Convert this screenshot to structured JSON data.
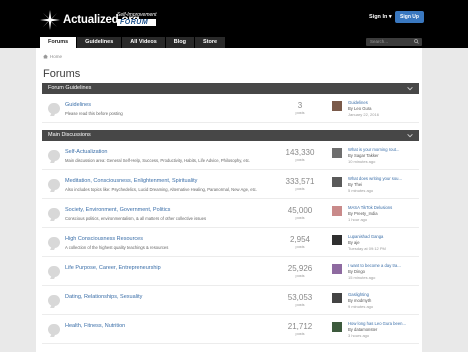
{
  "header": {
    "logo_text": "Actualized.org",
    "logo_tagline": "Self-Improvement",
    "logo_forum": "FORUM",
    "sign_in": "Sign In ▾",
    "sign_up": "Sign Up",
    "search_placeholder": "Search..."
  },
  "nav": {
    "tabs": [
      {
        "label": "Forums",
        "active": true
      },
      {
        "label": "Guidelines"
      },
      {
        "label": "All Videos"
      },
      {
        "label": "Blog"
      },
      {
        "label": "Store"
      }
    ]
  },
  "breadcrumb": {
    "home": "Home"
  },
  "page": {
    "title": "Forums"
  },
  "sections": [
    {
      "title": "Forum Guidelines",
      "forums": [
        {
          "title": "Guidelines",
          "desc": "Please read this before posting",
          "count": "3",
          "count_label": "posts",
          "last_title": "Guidelines",
          "last_by": "By Leo Gura",
          "last_time": "January 22, 2016",
          "avatar_color": "#7a5a4a"
        }
      ]
    },
    {
      "title": "Main Discussions",
      "forums": [
        {
          "title": "Self-Actualization",
          "desc": "Main discussion area: General Self-Help, Success, Productivity, Habits, Life Advice, Philosophy, etc.",
          "count": "143,330",
          "count_label": "posts",
          "last_title": "What is your morning rout...",
          "last_by": "By Sagar Takker",
          "last_time": "10 minutes ago",
          "avatar_color": "#6e6e6e"
        },
        {
          "title": "Meditation, Consciousness, Enlightenment, Spirituality",
          "desc": "Also includes topics like: Psychedelics, Lucid Dreaming, Alternative Healing, Paranormal, New Age, etc.",
          "count": "333,571",
          "count_label": "posts",
          "last_title": "What does writing your sou...",
          "last_by": "By Thei",
          "last_time": "5 minutes ago",
          "avatar_color": "#5a5a5a"
        },
        {
          "title": "Society, Environment, Government, Politics",
          "desc": "Conscious politics, environmentalism, & all matters of other collective issues",
          "count": "45,000",
          "count_label": "posts",
          "last_title": "MASA TikTok Delusions",
          "last_by": "By Preety_India",
          "last_time": "1 hour ago",
          "avatar_color": "#c98a8a"
        },
        {
          "title": "High Consciousness Resources",
          "desc": "A collection of the highest quality teachings & resources",
          "count": "2,954",
          "count_label": "posts",
          "last_title": "Lupanishad Ganga",
          "last_by": "By aje",
          "last_time": "Tuesday at 09:12 PM",
          "avatar_color": "#2f2f2f"
        },
        {
          "title": "Life Purpose, Career, Entrepreneurship",
          "desc": "",
          "count": "25,926",
          "count_label": "posts",
          "last_title": "I want to become a day tra...",
          "last_by": "By Dingo",
          "last_time": "15 minutes ago",
          "avatar_color": "#8e6aa0"
        },
        {
          "title": "Dating, Relationships, Sexuality",
          "desc": "",
          "count": "53,053",
          "count_label": "posts",
          "last_title": "Gaslighting",
          "last_by": "By modmyth",
          "last_time": "9 minutes ago",
          "avatar_color": "#444444"
        },
        {
          "title": "Health, Fitness, Nutrition",
          "desc": "",
          "count": "21,712",
          "count_label": "posts",
          "last_title": "How long has Leo Gura been...",
          "last_by": "By datamonster",
          "last_time": "3 hours ago",
          "avatar_color": "#3d5a3d"
        }
      ]
    }
  ]
}
